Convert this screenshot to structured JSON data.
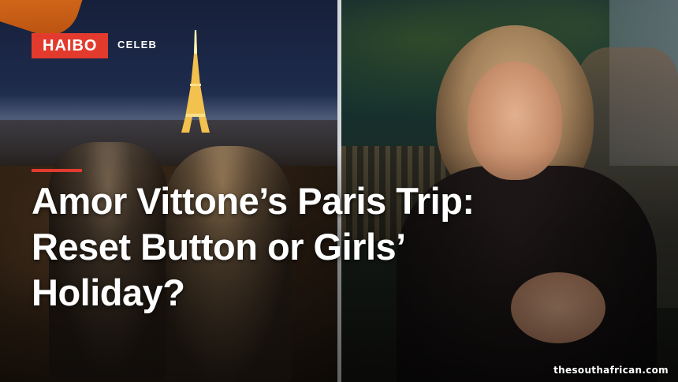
{
  "badge": {
    "label": "HAIBO",
    "color": "#e23b2e"
  },
  "category": {
    "label": "CELEB"
  },
  "headline": {
    "line1": "Amor Vittone’s Paris Trip:",
    "line2": "Reset Button or Girls’",
    "line3": "Holiday?"
  },
  "source": {
    "label": "thesouthafrican.com"
  }
}
